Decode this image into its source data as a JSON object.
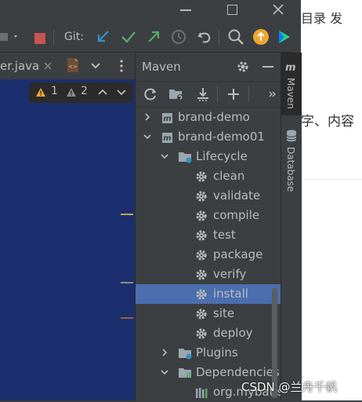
{
  "toolbar": {
    "git_label": "Git:"
  },
  "editor": {
    "tab_label": "er.java",
    "warnings": {
      "count_a": "1",
      "count_b": "2"
    }
  },
  "maven": {
    "title": "Maven",
    "tree": {
      "brand_demo": "brand-demo",
      "brand_demo01": "brand-demo01",
      "lifecycle": "Lifecycle",
      "goals": [
        "clean",
        "validate",
        "compile",
        "test",
        "package",
        "verify",
        "install",
        "site",
        "deploy"
      ],
      "selected_goal": "install",
      "plugins": "Plugins",
      "dependencies": "Dependencies",
      "dep_item": "org.mybatis"
    }
  },
  "right_strip": {
    "maven_label": "Maven",
    "database_label": "Database"
  },
  "browser": {
    "top_text": "目录  发",
    "mid_text": "字、内容",
    "watermark": "CSDN @兰舟千帆"
  },
  "colors": {
    "selection": "#4b6eaf",
    "editor_bg": "#1b2f6e",
    "panel_bg": "#3c3f41"
  }
}
